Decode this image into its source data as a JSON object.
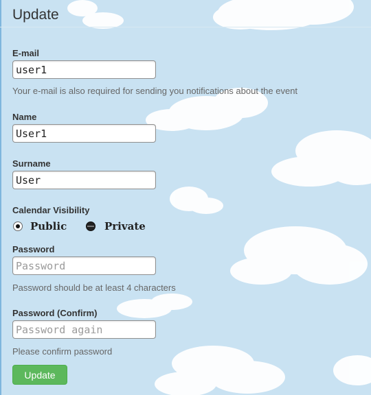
{
  "form": {
    "title": "Update",
    "email": {
      "label": "E-mail",
      "value": "user1",
      "help": "Your e-mail is also required for sending you notifications about the event"
    },
    "name": {
      "label": "Name",
      "value": "User1"
    },
    "surname": {
      "label": "Surname",
      "value": "User"
    },
    "visibility": {
      "label": "Calendar Visibility",
      "options": [
        "Public",
        "Private"
      ]
    },
    "password": {
      "label": "Password",
      "placeholder": "Password",
      "help": "Password should be at least 4 characters"
    },
    "confirm": {
      "label": "Password (Confirm)",
      "placeholder": "Password again",
      "help": "Please confirm password"
    },
    "submit_label": "Update"
  },
  "colors": {
    "sky": "#c9e2f2",
    "button": "#5cb85c"
  },
  "icons": {
    "radio_selected": "radio-selected-icon",
    "radio_unselected": "radio-unselected-icon"
  }
}
